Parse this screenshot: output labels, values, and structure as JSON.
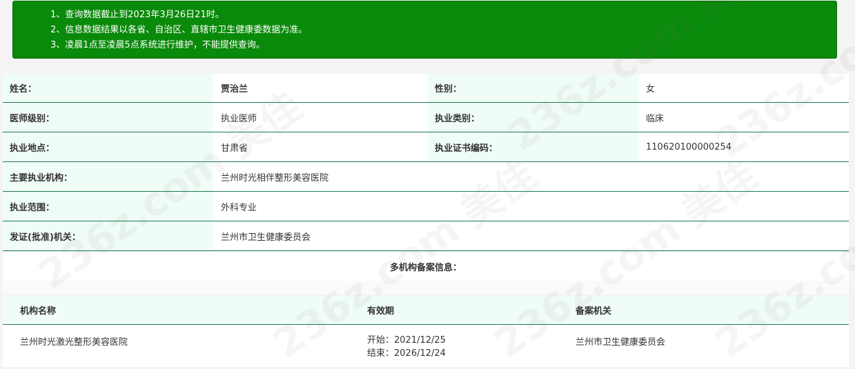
{
  "notice": {
    "lines": [
      "1、查询数据截止到2023年3月26日21时。",
      "2、信息数据结果以各省、自治区、直辖市卫生健康委数据为准。",
      "3、凌晨1点至凌晨5点系统进行维护，不能提供查询。"
    ]
  },
  "info": {
    "name_label": "姓名：",
    "name_value": "贾治兰",
    "gender_label": "性别：",
    "gender_value": "女",
    "level_label": "医师级别：",
    "level_value": "执业医师",
    "category_label": "执业类别：",
    "category_value": "临床",
    "location_label": "执业地点：",
    "location_value": "甘肃省",
    "cert_label": "执业证书编码：",
    "cert_value": "110620100000254",
    "institution_label": "主要执业机构：",
    "institution_value": "兰州时光相伴整形美容医院",
    "scope_label": "执业范围：",
    "scope_value": "外科专业",
    "issuer_label": "发证(批准)机关：",
    "issuer_value": "兰州市卫生健康委员会"
  },
  "multi": {
    "title": "多机构备案信息：",
    "headers": [
      "机构名称",
      "有效期",
      "备案机关"
    ],
    "rows": [
      {
        "name": "兰州时光激光整形美容医院",
        "start": "开始：2021/12/25",
        "end": "结束：2026/12/24",
        "authority": "兰州市卫生健康委员会"
      }
    ]
  },
  "watermark": "236z.com 美佳",
  "colors": {
    "notice_bg": "#0a8a0a",
    "label_bg": "#f0fcf6",
    "divider": "#1d7a55"
  }
}
